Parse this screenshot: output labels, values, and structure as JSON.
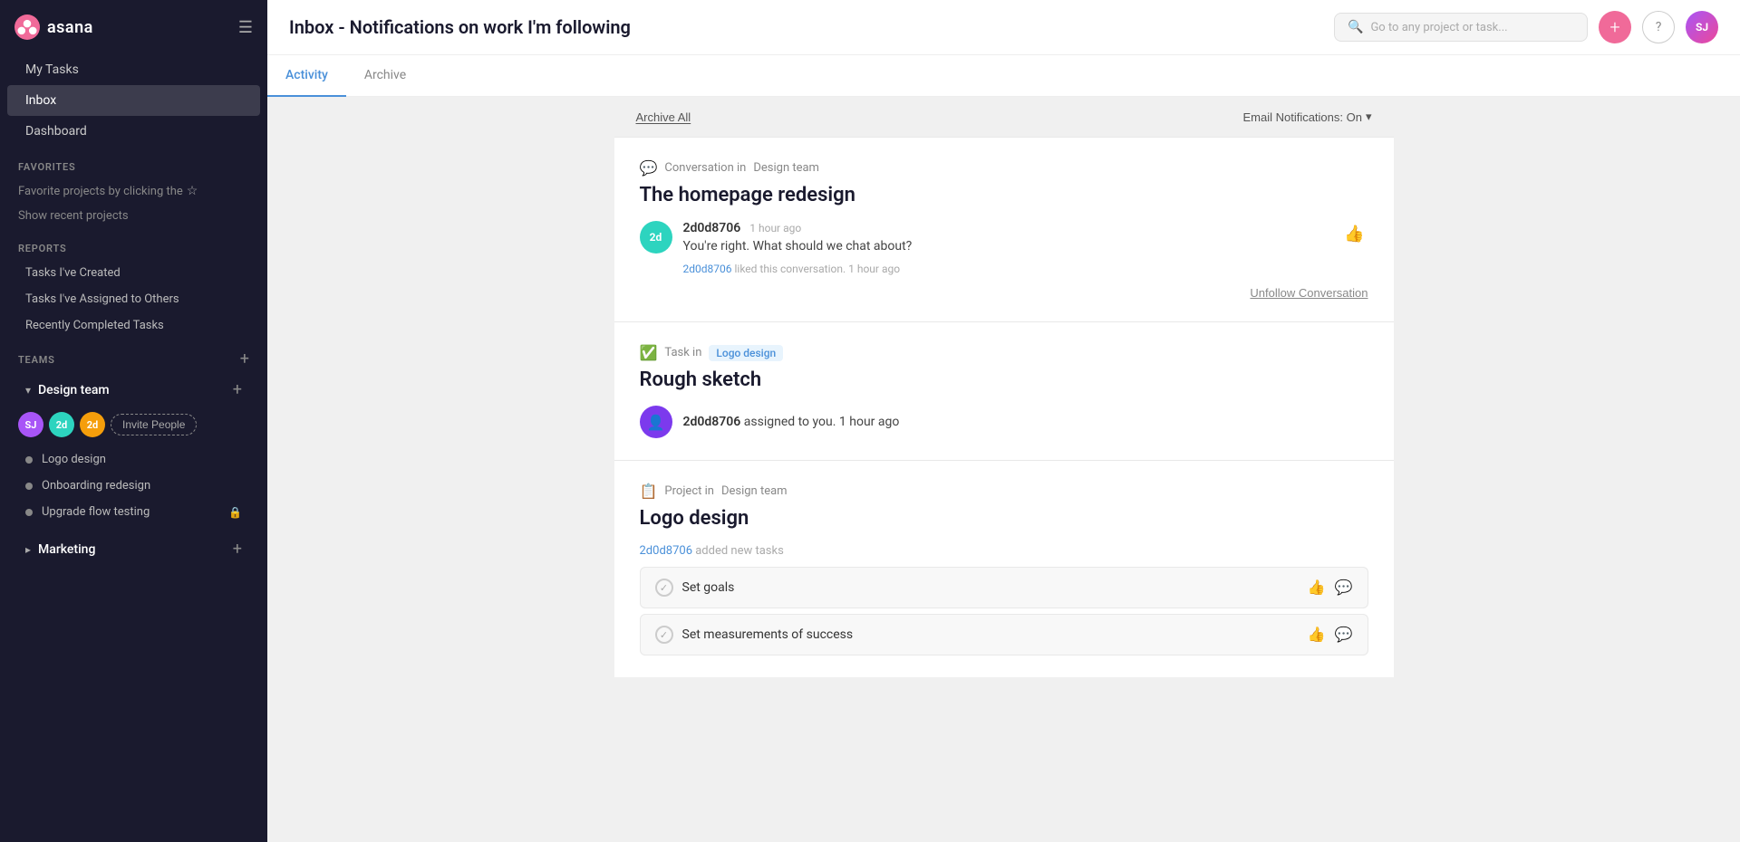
{
  "sidebar": {
    "logo": "asana",
    "logo_text": "asana",
    "nav_items": [
      {
        "id": "my-tasks",
        "label": "My Tasks"
      },
      {
        "id": "inbox",
        "label": "Inbox"
      },
      {
        "id": "dashboard",
        "label": "Dashboard"
      }
    ],
    "favorites_section": "Favorites",
    "favorites_hint": "Favorite projects by clicking the",
    "star_icon": "☆",
    "show_recent": "Show recent projects",
    "reports_section": "Reports",
    "reports_items": [
      {
        "id": "tasks-created",
        "label": "Tasks I've Created"
      },
      {
        "id": "tasks-assigned",
        "label": "Tasks I've Assigned to Others"
      },
      {
        "id": "recently-completed",
        "label": "Recently Completed Tasks"
      }
    ],
    "teams_section": "Teams",
    "teams": [
      {
        "id": "design-team",
        "label": "Design team",
        "members": [
          {
            "initials": "SJ",
            "color": "#a855f7"
          },
          {
            "initials": "2d",
            "color": "#2dd4bf"
          },
          {
            "initials": "2d",
            "color": "#f59e0b"
          }
        ],
        "invite_label": "Invite People",
        "projects": [
          {
            "id": "logo-design",
            "label": "Logo design",
            "locked": false
          },
          {
            "id": "onboarding-redesign",
            "label": "Onboarding redesign",
            "locked": false
          },
          {
            "id": "upgrade-flow-testing",
            "label": "Upgrade flow testing",
            "locked": true
          }
        ]
      },
      {
        "id": "marketing",
        "label": "Marketing",
        "members": []
      }
    ]
  },
  "header": {
    "title": "Inbox - Notifications on work I'm following",
    "search_placeholder": "Go to any project or task...",
    "user_initials": "SJ",
    "plus_btn": "+",
    "help_btn": "?"
  },
  "tabs": [
    {
      "id": "activity",
      "label": "Activity",
      "active": true
    },
    {
      "id": "archive",
      "label": "Archive",
      "active": false
    }
  ],
  "toolbar": {
    "archive_all": "Archive All",
    "email_notif": "Email Notifications: On",
    "email_notif_arrow": "▾"
  },
  "notifications": [
    {
      "id": "notif-1",
      "type": "conversation",
      "meta_icon": "💬",
      "meta_text": "Conversation in",
      "meta_context": "Design team",
      "title": "The homepage redesign",
      "comment": {
        "author": "2d0d8706",
        "initials": "2d",
        "avatar_color": "#2dd4bf",
        "time": "1 hour ago",
        "text": "You're right. What should we chat about?"
      },
      "liked_by": "2d0d8706",
      "liked_text": "liked this conversation.",
      "liked_time": "1 hour ago",
      "unfollow_label": "Unfollow Conversation"
    },
    {
      "id": "notif-2",
      "type": "task",
      "meta_icon": "✅",
      "meta_text": "Task in",
      "meta_context": "Logo design",
      "title": "Rough sketch",
      "assign": {
        "author": "2d0d8706",
        "time": "1 hour ago",
        "text": "assigned to you."
      }
    },
    {
      "id": "notif-3",
      "type": "project",
      "meta_icon": "📋",
      "meta_text": "Project in",
      "meta_context": "Design team",
      "title": "Logo design",
      "added_by": "2d0d8706",
      "added_text": "added new tasks",
      "tasks": [
        {
          "id": "task-set-goals",
          "label": "Set goals"
        },
        {
          "id": "task-set-measurements",
          "label": "Set measurements of success"
        }
      ]
    }
  ]
}
